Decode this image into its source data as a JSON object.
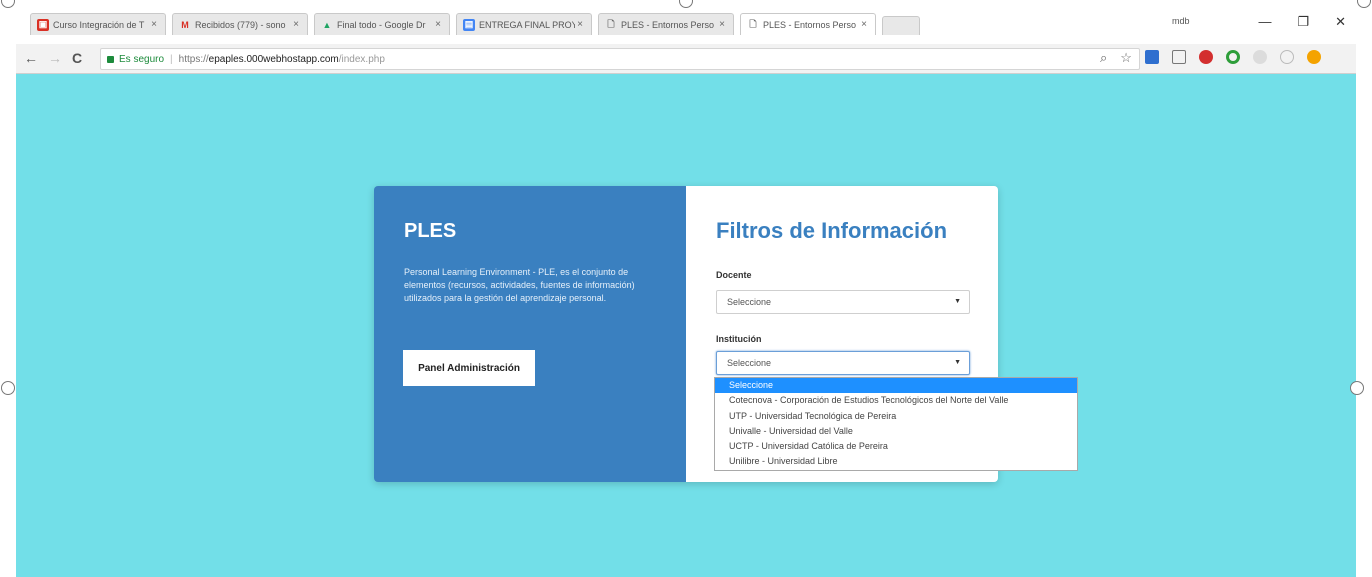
{
  "tabs": [
    {
      "title": "Curso Integración de T",
      "favicon_color": "#d93025",
      "favicon": "▣"
    },
    {
      "title": "Recibidos (779) - sono",
      "favicon_color": "#ffffff",
      "favicon": "M"
    },
    {
      "title": "Final todo - Google Dr",
      "favicon_color": "#1fa463",
      "favicon": "▲"
    },
    {
      "title": "ENTREGA FINAL PROY",
      "favicon_color": "#4285f4",
      "favicon": "▤"
    },
    {
      "title": "PLES - Entornos Perso",
      "favicon_color": "#ffffff",
      "favicon": "🗋"
    },
    {
      "title": "PLES - Entornos Perso",
      "favicon_color": "#ffffff",
      "favicon": "🗋"
    }
  ],
  "tab_close": "×",
  "profile_name": "mdb",
  "window_controls": {
    "minimize": "—",
    "maximize": "❐",
    "close": "✕"
  },
  "nav": {
    "back": "←",
    "forward": "→",
    "reload": "C"
  },
  "address": {
    "secure_label": "Es seguro",
    "separator": "|",
    "protocol": "https://",
    "host": "epaples.000webhostapp.com",
    "path": "/index.php"
  },
  "left_panel": {
    "title": "PLES",
    "description": "Personal Learning Environment - PLE, es el conjunto de elementos (recursos, actividades, fuentes de información) utilizados para la gestión del aprendizaje personal.",
    "admin_button": "Panel Administración"
  },
  "right_panel": {
    "title": "Filtros de Información",
    "docente_label": "Docente",
    "docente_value": "Seleccione",
    "institucion_label": "Institución",
    "institucion_value": "Seleccione"
  },
  "institucion_options": [
    "Seleccione",
    "Cotecnova - Corporación de Estudios Tecnológicos del Norte del Valle",
    "UTP - Universidad Tecnológica de Pereira",
    "Univalle - Universidad del Valle",
    "UCTP - Universidad Católica de Pereira",
    "Unilibre - Universidad Libre"
  ],
  "colors": {
    "page_background": "#72dfe8",
    "left_panel": "#3a80c0",
    "title_blue": "#3a80c0",
    "option_highlight": "#1e90ff"
  }
}
